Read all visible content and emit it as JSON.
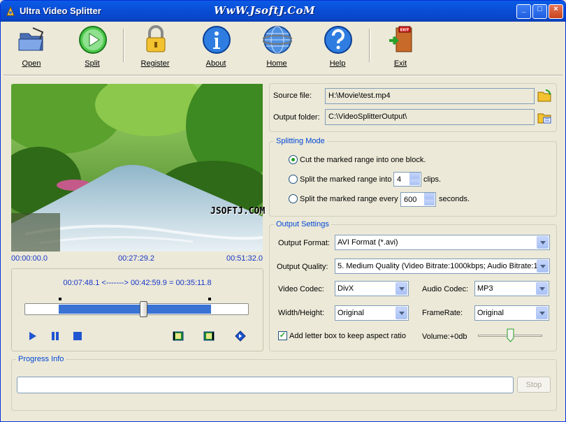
{
  "window": {
    "title": "Ultra Video Splitter",
    "watermark": "WwW.JsoftJ.CoM",
    "overlay_watermark": "JSOFTJ.COM",
    "controls": {
      "minimize": "_",
      "maximize": "□",
      "close": "×"
    }
  },
  "toolbar": {
    "buttons": [
      {
        "label": "Open",
        "icon": "open-folder-icon"
      },
      {
        "label": "Split",
        "icon": "play-split-icon"
      },
      {
        "label": "Register",
        "icon": "padlock-icon"
      },
      {
        "label": "About",
        "icon": "info-icon"
      },
      {
        "label": "Home",
        "icon": "globe-icon"
      },
      {
        "label": "Help",
        "icon": "help-icon"
      },
      {
        "label": "Exit",
        "icon": "exit-door-icon"
      }
    ],
    "exit_sign": "EXIT"
  },
  "player": {
    "time_start": "00:00:00.0",
    "time_mid": "00:27:29.2",
    "time_end": "00:51:32.0",
    "range_text": "00:07:48.1 <-------> 00:42:59.9 = 00:35:11.8",
    "position": 0.533,
    "selection_start": 0.151,
    "selection_end": 0.834
  },
  "files": {
    "source_label": "Source file:",
    "source_value": "H:\\Movie\\test.mp4",
    "output_label": "Output folder:",
    "output_value": "C:\\VideoSplitterOutput\\"
  },
  "splitting": {
    "title": "Splitting Mode",
    "option1": "Cut the marked range into one block.",
    "option2_pre": "Split the marked range into",
    "option2_value": "4",
    "option2_post": "clips.",
    "option3_pre": "Split the marked range every",
    "option3_value": "600",
    "option3_post": "seconds.",
    "selected": 1
  },
  "output": {
    "title": "Output Settings",
    "format_label": "Output Format:",
    "format_value": "AVI Format (*.avi)",
    "quality_label": "Output Quality:",
    "quality_value": "5. Medium Quality   (Video Bitrate:1000kbps; Audio Bitrate:1",
    "vcodec_label": "Video Codec:",
    "vcodec_value": "DivX",
    "acodec_label": "Audio Codec:",
    "acodec_value": "MP3",
    "wh_label": "Width/Height:",
    "wh_value": "Original",
    "fr_label": "FrameRate:",
    "fr_value": "Original",
    "letterbox_label": "Add letter box to keep aspect ratio",
    "letterbox_checked": true,
    "volume_label": "Volume:+0db",
    "volume_level": 0.5
  },
  "progress": {
    "title": "Progress Info",
    "stop_label": "Stop",
    "percent": 0
  }
}
